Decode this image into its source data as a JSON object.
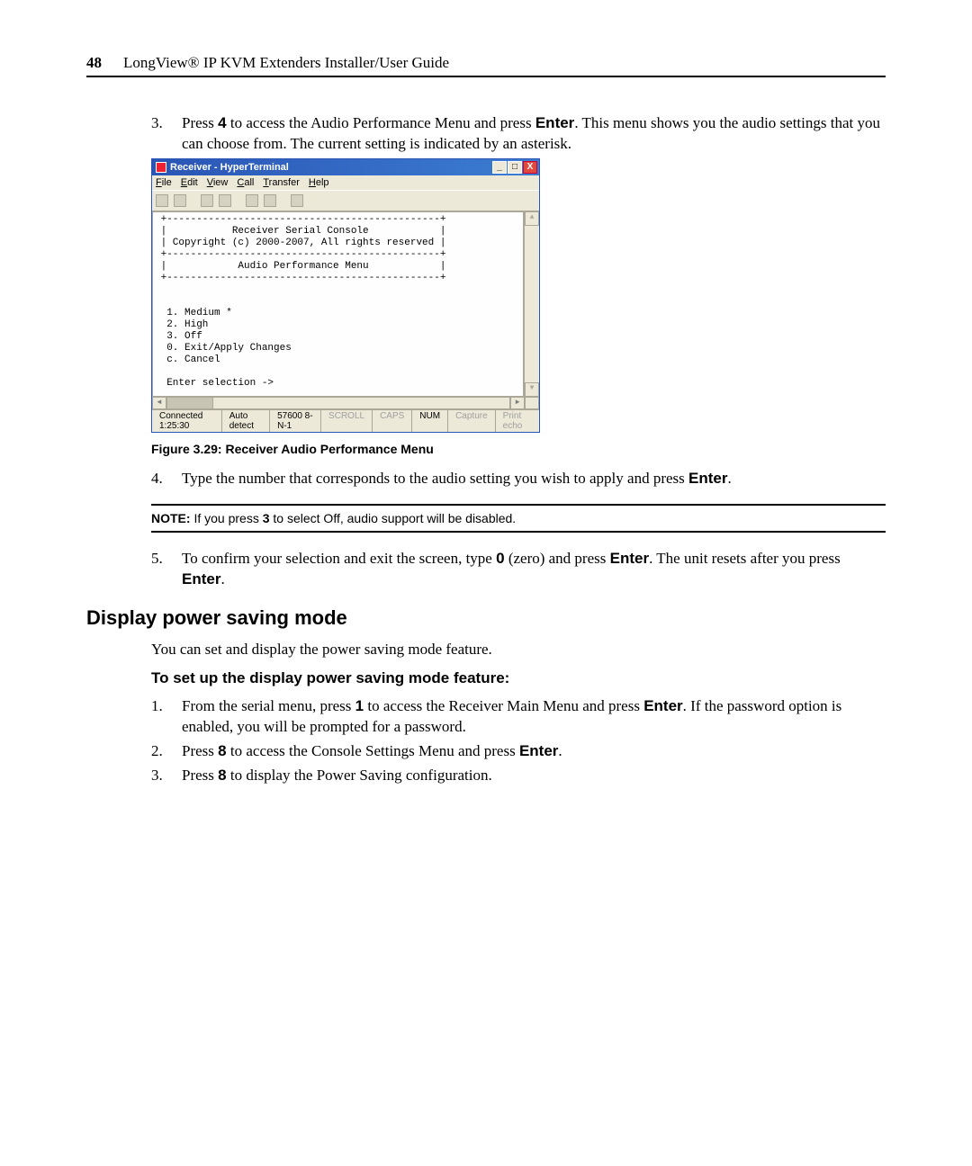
{
  "header": {
    "page_number": "48",
    "book_title": "LongView® IP KVM Extenders Installer/User Guide"
  },
  "step3": {
    "num": "3.",
    "pre": "Press ",
    "key": "4",
    "mid": " to access the Audio Performance Menu and press ",
    "enter": "Enter",
    "post": ". This menu shows you the audio settings that you can choose from. The current setting is indicated by an asterisk."
  },
  "hyperterminal": {
    "title": "Receiver - HyperTerminal",
    "winbtns": {
      "min": "_",
      "max": "□",
      "close": "X"
    },
    "menu": [
      "File",
      "Edit",
      "View",
      "Call",
      "Transfer",
      "Help"
    ],
    "terminal_text": " +----------------------------------------------+\n |           Receiver Serial Console            |\n | Copyright (c) 2000-2007, All rights reserved |\n +----------------------------------------------+\n |            Audio Performance Menu            |\n +----------------------------------------------+\n\n\n  1. Medium *\n  2. High\n  3. Off\n  0. Exit/Apply Changes\n  c. Cancel\n\n  Enter selection ->",
    "status": {
      "connected": "Connected 1:25:30",
      "detect": "Auto detect",
      "conn": "57600 8-N-1",
      "scroll": "SCROLL",
      "caps": "CAPS",
      "num": "NUM",
      "capture": "Capture",
      "printecho": "Print echo"
    }
  },
  "figure_caption": "Figure 3.29: Receiver Audio Performance Menu",
  "step4": {
    "num": "4.",
    "pre": "Type the number that corresponds to the audio setting you wish to apply and press ",
    "enter": "Enter",
    "post": "."
  },
  "note": {
    "label": "NOTE:",
    "pre": " If you press ",
    "key": "3",
    "post": " to select Off, audio support will be disabled."
  },
  "step5": {
    "num": "5.",
    "pre": "To confirm your selection and exit the screen, type ",
    "key": "0",
    "mid": " (zero) and press ",
    "enter": "Enter",
    "post1": ". The unit resets after you press ",
    "enter2": "Enter",
    "post2": "."
  },
  "section_heading": "Display power saving mode",
  "section_intro": "You can set and display the power saving mode feature.",
  "procedure_heading": "To set up the display power saving mode feature:",
  "pstep1": {
    "num": "1.",
    "pre": "From the serial menu, press ",
    "key": "1",
    "mid": " to access the Receiver Main Menu and press ",
    "enter": "Enter",
    "post": ". If the password option is enabled, you will be prompted for a password."
  },
  "pstep2": {
    "num": "2.",
    "pre": "Press ",
    "key": "8",
    "mid": " to access the Console Settings Menu and press ",
    "enter": "Enter",
    "post": "."
  },
  "pstep3": {
    "num": "3.",
    "pre": "Press ",
    "key": "8",
    "post": " to display the Power Saving configuration."
  }
}
